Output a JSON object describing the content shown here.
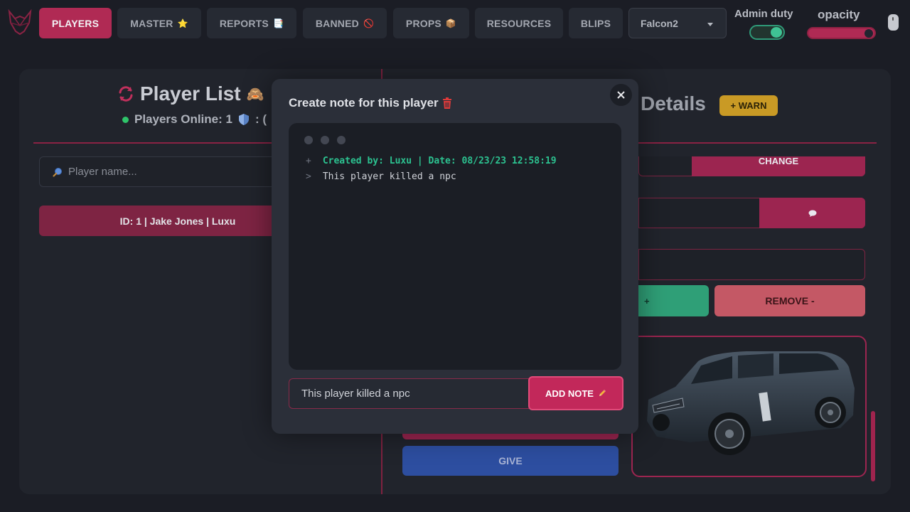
{
  "nav": {
    "tabs": [
      {
        "label": "PLAYERS",
        "emoji": ""
      },
      {
        "label": "MASTER",
        "emoji": "⭐"
      },
      {
        "label": "REPORTS",
        "emoji": "📑"
      },
      {
        "label": "BANNED",
        "emoji": "🚫"
      },
      {
        "label": "PROPS",
        "emoji": "📦"
      },
      {
        "label": "RESOURCES",
        "emoji": ""
      },
      {
        "label": "BLIPS",
        "emoji": ""
      }
    ],
    "selected_tab": "PLAYERS",
    "select_value": "Falcon2",
    "admin_duty_label": "Admin duty",
    "admin_duty_on": true,
    "opacity_label": "opacity",
    "opacity_value": 1.0
  },
  "player_list": {
    "title": "Player List",
    "title_emoji": "🙈",
    "online_text": "Players Online: 1",
    "admin_count_prefix": ": (",
    "search_placeholder": "Player name...",
    "rows": [
      "ID: 1 | Jake Jones | Luxu"
    ]
  },
  "details": {
    "title": "Details",
    "warn_label": "+ WARN",
    "change_label": "CHANGE",
    "add_label": "+",
    "remove_label": "REMOVE -",
    "give_label": "GIVE"
  },
  "modal": {
    "title": "Create note for this player",
    "lines": [
      {
        "prefix": "+",
        "text": "Created by: Luxu | Date: 08/23/23 12:58:19",
        "kind": "meta"
      },
      {
        "prefix": ">",
        "text": "This player killed a npc",
        "kind": "text"
      }
    ],
    "input_value": "This player killed a npc",
    "add_note_label": "ADD NOTE"
  },
  "colors": {
    "accent": "#b02a54",
    "terminal_meta": "#2cc290",
    "warn": "#c99a25",
    "give": "#2d4ea0"
  }
}
